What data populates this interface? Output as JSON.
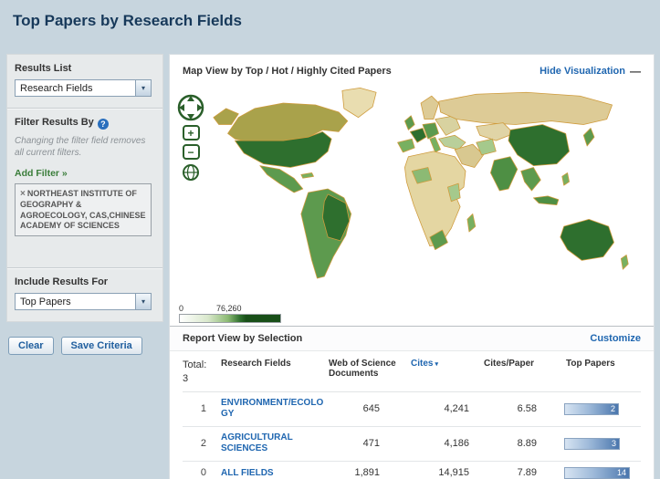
{
  "page": {
    "title": "Top Papers by Research Fields"
  },
  "icons": {
    "chevron_down": "▾",
    "help": "?",
    "remove": "×",
    "sort_down": "▾",
    "minus": "—",
    "zoom_in": "+",
    "zoom_out": "−"
  },
  "sidebar": {
    "results_list_label": "Results List",
    "results_list_value": "Research Fields",
    "filter_by_label": "Filter Results By",
    "filter_note": "Changing the filter field removes all current filters.",
    "add_filter_label": "Add Filter »",
    "active_filter_text": "NORTHEAST INSTITUTE OF GEOGRAPHY & AGROECOLOGY, CAS,CHINESE ACADEMY OF SCIENCES",
    "include_results_label": "Include Results For",
    "include_results_value": "Top Papers",
    "clear_button": "Clear",
    "save_button": "Save Criteria"
  },
  "map": {
    "title": "Map View by  Top / Hot / Highly Cited Papers",
    "hide_link": "Hide Visualization",
    "legend_min": "0",
    "legend_max": "76,260",
    "legend_min_color": "#ffffff",
    "legend_max_color": "#184f18",
    "border_color": "#cf9b3c"
  },
  "report": {
    "header": "Report View by Selection",
    "customize_link": "Customize",
    "total_label": "Total:",
    "total_value": "3",
    "columns": [
      "Research Fields",
      "Web of Science Documents",
      "Cites",
      "Cites/Paper",
      "Top Papers"
    ],
    "rows": [
      {
        "rank": "1",
        "field": "ENVIRONMENT/ECOLOGY",
        "docs": "645",
        "cites": "4,241",
        "cites_per_paper": "6.58",
        "top_papers": 2
      },
      {
        "rank": "2",
        "field": "AGRICULTURAL SCIENCES",
        "docs": "471",
        "cites": "4,186",
        "cites_per_paper": "8.89",
        "top_papers": 3
      },
      {
        "rank": "0",
        "field": "ALL FIELDS",
        "docs": "1,891",
        "cites": "14,915",
        "cites_per_paper": "7.89",
        "top_papers": 14
      }
    ]
  }
}
